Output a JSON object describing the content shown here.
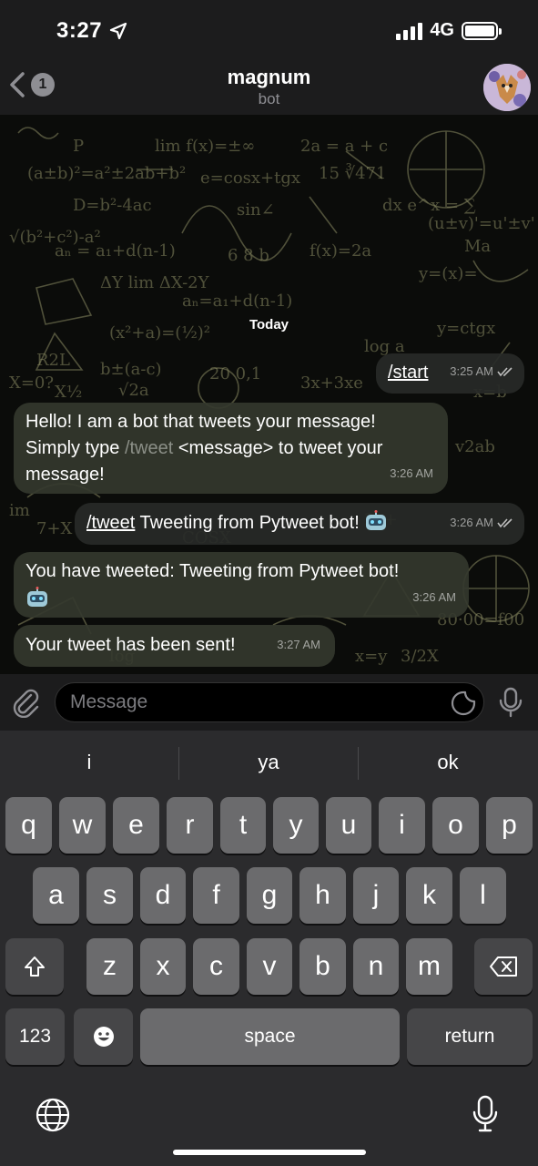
{
  "status": {
    "time": "3:27",
    "network": "4G"
  },
  "header": {
    "back_count": "1",
    "title": "magnum",
    "subtitle": "bot"
  },
  "chat": {
    "date_label": "Today",
    "messages": [
      {
        "cmd": "/start",
        "time": "3:25 AM"
      },
      {
        "line1": "Hello! I am a bot that tweets your message!",
        "line2_pre": "Simply type ",
        "line2_cmd": "/tweet",
        "line2_post": " <message> to tweet your",
        "line3": "message!",
        "time": "3:26 AM"
      },
      {
        "cmd": "/tweet",
        "text": " Tweeting from Pytweet bot! ",
        "time": "3:26 AM"
      },
      {
        "line1": "You have tweeted:  Tweeting from Pytweet bot!",
        "time": "3:26 AM"
      },
      {
        "text": "Your tweet has been sent!",
        "time": "3:27 AM"
      }
    ]
  },
  "input": {
    "placeholder": "Message"
  },
  "keyboard": {
    "suggestions": [
      "i",
      "ya",
      "ok"
    ],
    "row1": [
      "q",
      "w",
      "e",
      "r",
      "t",
      "y",
      "u",
      "i",
      "o",
      "p"
    ],
    "row2": [
      "a",
      "s",
      "d",
      "f",
      "g",
      "h",
      "j",
      "k",
      "l"
    ],
    "row3": [
      "z",
      "x",
      "c",
      "v",
      "b",
      "n",
      "m"
    ],
    "numbers_label": "123",
    "space_label": "space",
    "return_label": "return"
  }
}
